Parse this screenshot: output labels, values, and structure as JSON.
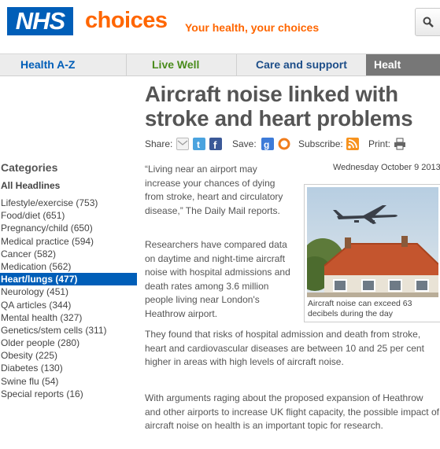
{
  "header": {
    "logo_text": "NHS",
    "brand": "choices",
    "tagline": "Your health, your choices",
    "search_icon": "search-icon"
  },
  "nav": {
    "tabs": [
      {
        "label": "Health A-Z",
        "color": "#005eb8"
      },
      {
        "label": "Live Well",
        "color": "#4a8c1c"
      },
      {
        "label": "Care and support",
        "color": "#1d4e89"
      },
      {
        "label": "Healt",
        "color": "#777777",
        "active": true
      }
    ]
  },
  "article": {
    "title": "Aircraft noise linked with stroke and heart problems",
    "date": "Wednesday October 9 2013",
    "paragraphs": [
      "“Living near an airport may increase your chances of dying from stroke, heart and circulatory disease,” The Daily Mail reports.",
      "Researchers have compared data on daytime and night-time aircraft noise with hospital admissions and death rates among 3.6 million people living near London's Heathrow airport.",
      "They found that risks of hospital admission and death from stroke, heart and cardiovascular diseases are between 10 and 25 per cent higher in areas with high levels of aircraft noise.",
      "With arguments raging about the proposed expansion of Heathrow and other airports to increase UK flight capacity, the possible impact of aircraft noise on health is an important topic for research."
    ],
    "figure_caption": "Aircraft noise can exceed 63 decibels during the day"
  },
  "share": {
    "share_label": "Share:",
    "save_label": "Save:",
    "subscribe_label": "Subscribe:",
    "print_label": "Print:",
    "icons": [
      "email-icon",
      "twitter-icon",
      "facebook-icon",
      "google-icon",
      "delicious-icon",
      "rss-icon",
      "print-icon"
    ]
  },
  "sidebar": {
    "title": "Categories",
    "all_label": "All Headlines",
    "items": [
      {
        "label": "Lifestyle/exercise (753)"
      },
      {
        "label": "Food/diet (651)"
      },
      {
        "label": "Pregnancy/child (650)"
      },
      {
        "label": "Medical practice (594)"
      },
      {
        "label": "Cancer (582)"
      },
      {
        "label": "Medication (562)"
      },
      {
        "label": "Heart/lungs (477)",
        "active": true
      },
      {
        "label": "Neurology (451)"
      },
      {
        "label": "QA articles (344)"
      },
      {
        "label": "Mental health (327)"
      },
      {
        "label": "Genetics/stem cells (311)"
      },
      {
        "label": "Older people (280)"
      },
      {
        "label": "Obesity (225)"
      },
      {
        "label": "Diabetes (130)"
      },
      {
        "label": "Swine flu (54)"
      },
      {
        "label": "Special reports (16)"
      }
    ]
  },
  "colors": {
    "nhs_blue": "#005eb8",
    "brand_orange": "#ff6600",
    "live_well_green": "#4a8c1c"
  }
}
